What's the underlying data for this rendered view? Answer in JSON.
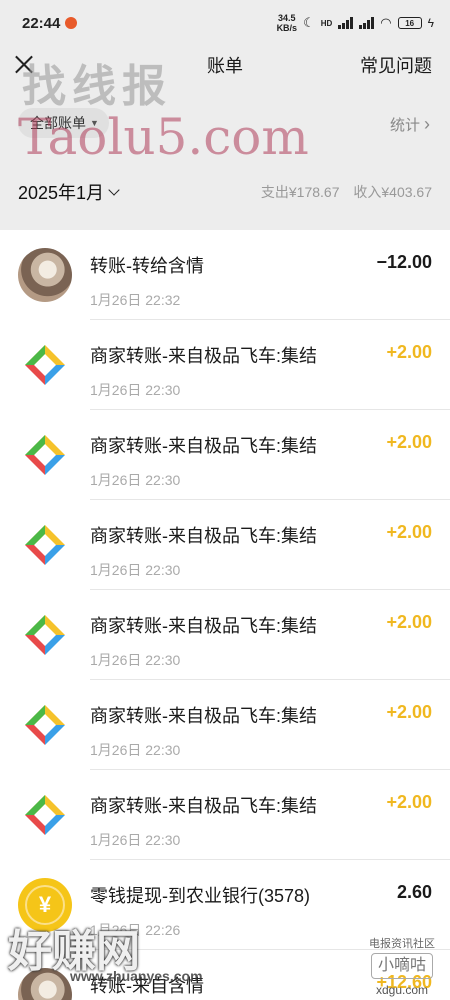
{
  "status_bar": {
    "time": "22:44",
    "net_speed_value": "34.5",
    "net_speed_unit": "KB/s",
    "network_tag": "HD",
    "battery": "16"
  },
  "header": {
    "title": "账单",
    "faq": "常见问题"
  },
  "filter": {
    "label": "全部账单",
    "stats": "统计"
  },
  "month": {
    "label": "2025年1月",
    "expense": "支出¥178.67",
    "income": "收入¥403.67"
  },
  "transactions": [
    {
      "desc": "转账-转给含情",
      "time": "1月26日 22:32",
      "amount": "−12.00",
      "kind": "negative",
      "icon": "user-photo"
    },
    {
      "desc": "商家转账-来自极品飞车:集结",
      "time": "1月26日 22:30",
      "amount": "+2.00",
      "kind": "positive",
      "icon": "merchant-transfer"
    },
    {
      "desc": "商家转账-来自极品飞车:集结",
      "time": "1月26日 22:30",
      "amount": "+2.00",
      "kind": "positive",
      "icon": "merchant-transfer"
    },
    {
      "desc": "商家转账-来自极品飞车:集结",
      "time": "1月26日 22:30",
      "amount": "+2.00",
      "kind": "positive",
      "icon": "merchant-transfer"
    },
    {
      "desc": "商家转账-来自极品飞车:集结",
      "time": "1月26日 22:30",
      "amount": "+2.00",
      "kind": "positive",
      "icon": "merchant-transfer"
    },
    {
      "desc": "商家转账-来自极品飞车:集结",
      "time": "1月26日 22:30",
      "amount": "+2.00",
      "kind": "positive",
      "icon": "merchant-transfer"
    },
    {
      "desc": "商家转账-来自极品飞车:集结",
      "time": "1月26日 22:30",
      "amount": "+2.00",
      "kind": "positive",
      "icon": "merchant-transfer"
    },
    {
      "desc": "零钱提现-到农业银行(3578)",
      "time": "1月26日 22:26",
      "amount": "2.60",
      "kind": "neutral",
      "icon": "yen-coin"
    },
    {
      "desc": "转账-来自含情",
      "time": "",
      "amount": "+12.60",
      "kind": "positive",
      "icon": "user-photo"
    }
  ],
  "watermarks": {
    "top": "找线报",
    "taolu": "Taolu5.com",
    "bottom": "好赚网",
    "bottom_url": "www.zhuanyes.com",
    "right_top": "电报资讯社区",
    "right_box": "小嘀咕",
    "right_url": "xdgu.com"
  },
  "colors": {
    "positive_amount": "#f0b820",
    "header_bg": "#ededed"
  }
}
